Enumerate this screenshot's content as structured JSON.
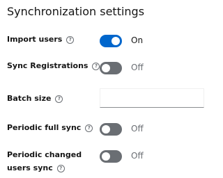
{
  "section": {
    "title": "Synchronization settings"
  },
  "fields": {
    "import_users": {
      "label": "Import users",
      "state_label": "On",
      "enabled": true
    },
    "sync_registrations": {
      "label": "Sync Registrations",
      "state_label": "Off",
      "enabled": false
    },
    "batch_size": {
      "label": "Batch size",
      "value": ""
    },
    "periodic_full_sync": {
      "label": "Periodic full sync",
      "state_label": "Off",
      "enabled": false
    },
    "periodic_changed_users_sync": {
      "label_line1": "Periodic changed",
      "label_line2": "users sync",
      "state_label": "Off",
      "enabled": false
    }
  },
  "icons": {
    "help": "help-circle-icon"
  },
  "colors": {
    "switch_on": "#0066cc",
    "switch_off": "#6a6e73",
    "text": "#151515",
    "muted": "#6a6e73"
  }
}
